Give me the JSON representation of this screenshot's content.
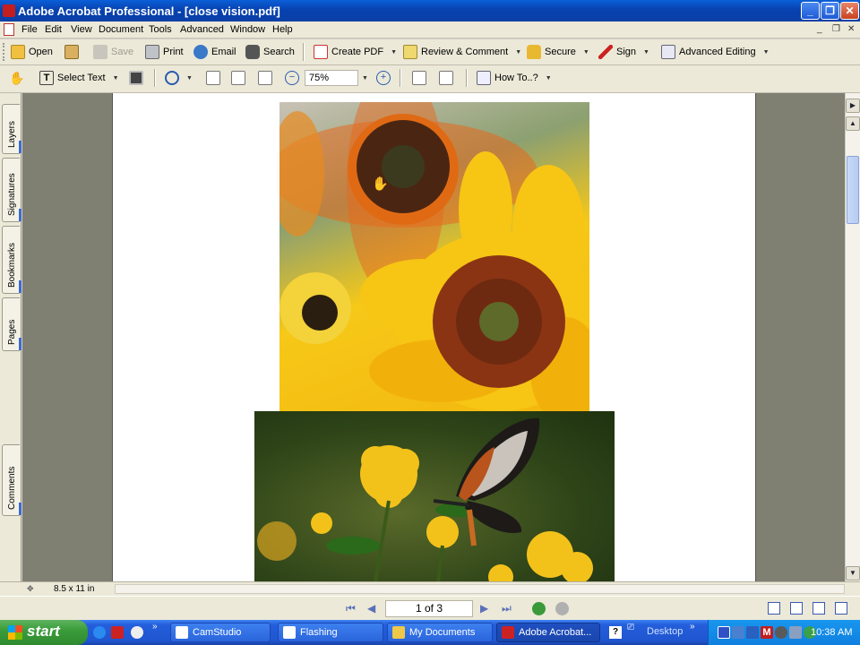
{
  "window": {
    "title": "Adobe Acrobat Professional - [close vision.pdf]"
  },
  "menu": [
    "File",
    "Edit",
    "View",
    "Document",
    "Tools",
    "Advanced",
    "Window",
    "Help"
  ],
  "toolbar1": {
    "open": "Open",
    "save": "Save",
    "print": "Print",
    "email": "Email",
    "search": "Search",
    "create_pdf": "Create PDF",
    "review_comment": "Review & Comment",
    "secure": "Secure",
    "sign": "Sign",
    "advanced_editing": "Advanced Editing"
  },
  "toolbar2": {
    "select_text": "Select Text",
    "zoom": "75%",
    "how_to": "How To..?"
  },
  "nav_tabs": [
    "Layers",
    "Signatures",
    "Bookmarks",
    "Pages",
    "Comments"
  ],
  "status": {
    "page_size": "8.5 x 11 in"
  },
  "navigation": {
    "page_indicator": "1 of 3"
  },
  "taskbar": {
    "start": "start",
    "tasks": [
      "CamStudio",
      "Flashing",
      "My Documents",
      "Adobe Acrobat..."
    ],
    "desktop": "Desktop",
    "clock": "10:38 AM"
  },
  "colors": {
    "title_bar": "#0a4fc4",
    "document_bg": "#7f7f72",
    "taskbar": "#245edb",
    "start_button": "#3b9c3b"
  }
}
